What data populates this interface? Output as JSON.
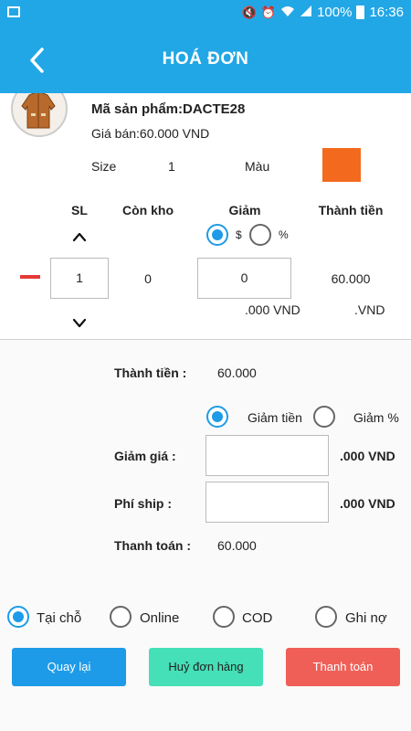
{
  "status_bar": {
    "battery_text": "100%",
    "time": "16:36"
  },
  "header": {
    "title": "HOÁ ĐƠN"
  },
  "product": {
    "code_text": "Mã sản phẩm:DACTE28",
    "price_text": "Giá bán:60.000 VND",
    "size_label": "Size",
    "size_value": "1",
    "color_label": "Màu",
    "color_value": "#f36a1f"
  },
  "order_table": {
    "headers": [
      "SL",
      "Còn kho",
      "Giảm",
      "Thành tiền"
    ],
    "quantity": "1",
    "stock": "0",
    "discount_value": "0",
    "line_total": "60.000",
    "discount_unit": ".000 VND",
    "total_unit": ".VND",
    "discount_type_options": [
      {
        "label": "$",
        "selected": true
      },
      {
        "label": "%",
        "selected": false
      }
    ]
  },
  "summary": {
    "subtotal_label": "Thành tiền :",
    "subtotal_value": "60.000",
    "discount_mode_options": [
      {
        "label": "Giảm tiền",
        "selected": true
      },
      {
        "label": "Giảm %",
        "selected": false
      }
    ],
    "discount_label": "Giảm giá :",
    "discount_input": "",
    "discount_unit": ".000 VND",
    "shipping_label": "Phí ship :",
    "shipping_input": "",
    "shipping_unit": ".000 VND",
    "payment_label": "Thanh toán :",
    "payment_value": "60.000"
  },
  "payment_methods": [
    {
      "label": "Tại chỗ",
      "selected": true
    },
    {
      "label": "Online",
      "selected": false
    },
    {
      "label": "COD",
      "selected": false
    },
    {
      "label": "Ghi nợ",
      "selected": false
    }
  ],
  "buttons": {
    "back": "Quay lại",
    "cancel": "Huỷ đơn hàng",
    "pay": "Thanh toán"
  },
  "colors": {
    "primary": "#22a7e6",
    "back_button": "#1e9be8",
    "cancel_button": "#45e0b8",
    "pay_button": "#ef5f58",
    "minus": "#e53935"
  }
}
